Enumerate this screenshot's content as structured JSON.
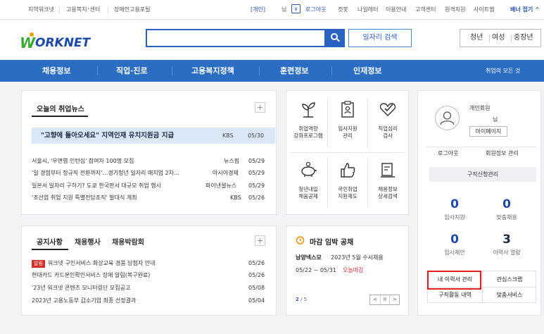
{
  "topbar": {
    "links": [
      "지역워크넷",
      "고용복지⁺센터",
      "장애인고용포털"
    ],
    "user_type": "[개인]",
    "user_name": "님",
    "right_links": [
      "로그아웃",
      "컷봇",
      "나일레터",
      "이용안내",
      "고객센터",
      "원격지원",
      "사이트맵"
    ],
    "banner": "배너 접기 ^"
  },
  "header": {
    "logo_text": "ORKNET",
    "logo_w": "W",
    "search_placeholder": "",
    "job_search_label": "일자리 검색",
    "age_groups": [
      "청년",
      "여성",
      "중장년"
    ]
  },
  "nav": {
    "items": [
      "채용정보",
      "직업·진로",
      "고용복지정책",
      "훈련정보",
      "인재정보"
    ],
    "all_jobs": "취업의 모든 것"
  },
  "news": {
    "title": "오늘의 취업뉴스",
    "headline": {
      "text": "\"고향에 돌아오세요\" 지역인재 유치지원금 지급",
      "source": "KBS",
      "date": "05/30"
    },
    "items": [
      {
        "text": "서울시, '우면엽 인턴십' 참여자 100명 모집",
        "source": "뉴스핌",
        "date": "05/29"
      },
      {
        "text": "'일 경험부터 정규직 전환까지'…경기청년 일자리 매치업 2차…",
        "source": "아시아경제",
        "date": "05/29"
      },
      {
        "text": "일본서 일자리 구하기? 도쿄 한국판서 대규모 취업 행사",
        "source": "파이낸셜뉴스",
        "date": "05/29"
      },
      {
        "text": "'조선업 취업 지원 특별전담조직' 발대식 개최",
        "source": "KBS",
        "date": "05/26"
      }
    ]
  },
  "notice": {
    "tabs": [
      "공지사항",
      "채용행사",
      "채용박람회"
    ],
    "items": [
      {
        "badge": "알림",
        "text": "워크넷 구인서비스 화상교육 경품 당첨자 안내",
        "date": "05/26"
      },
      {
        "badge": "",
        "text": "현대카드 카드본인확인서비스 장애 알림(복구완료)",
        "date": "05/26"
      },
      {
        "badge": "",
        "text": "'23년 워크넷 콘텐츠 모니터링단 모집공고",
        "date": "05/08"
      },
      {
        "badge": "",
        "text": "2023년 고용노동부 갑소기업 최종 선정결과",
        "date": "05/04"
      }
    ]
  },
  "services": [
    {
      "line1": "취업역량",
      "line2": "강화프로그램",
      "icon": "sprout-icon"
    },
    {
      "line1": "임사지원",
      "line2": "관리",
      "icon": "clipboard-icon"
    },
    {
      "line1": "직업심리",
      "line2": "검사",
      "icon": "check-heart-icon"
    },
    {
      "line1": "청년내일",
      "line2": "채움공제",
      "icon": "piggy-bank-icon"
    },
    {
      "line1": "국민취업",
      "line2": "지원제도",
      "icon": "thumbs-up-icon"
    },
    {
      "line1": "채용정보",
      "line2": "상세검색",
      "icon": "detail-search-icon"
    }
  ],
  "deadline": {
    "title": "마감 임박 공채",
    "company": "남양넥스모",
    "job": "2023년 5월 수시채용",
    "period": "05/22 ~ 05/31",
    "today_close": "오늘마감",
    "page": "2",
    "total": "/ 5",
    "pager": [
      "<",
      "II",
      ">"
    ]
  },
  "member": {
    "type": "개인회원",
    "name": "님",
    "mypage": "마이페이지",
    "logout": "로그아웃",
    "info": "회원정보 관리",
    "job_request": "구직신청관리",
    "stats": [
      {
        "value": "0",
        "label": "입사지원",
        "color": "#1a4aa5"
      },
      {
        "value": "0",
        "label": "맞춤채용",
        "color": "#1a4aa5"
      },
      {
        "value": "0",
        "label": "입사제안",
        "color": "#1a4aa5"
      },
      {
        "value": "3",
        "label": "이력서 열람",
        "color": "#1c2a44"
      }
    ],
    "buttons": [
      "내 이력서 관리",
      "관심스크랩",
      "구직활동 내역",
      "맞춤서비스"
    ]
  }
}
